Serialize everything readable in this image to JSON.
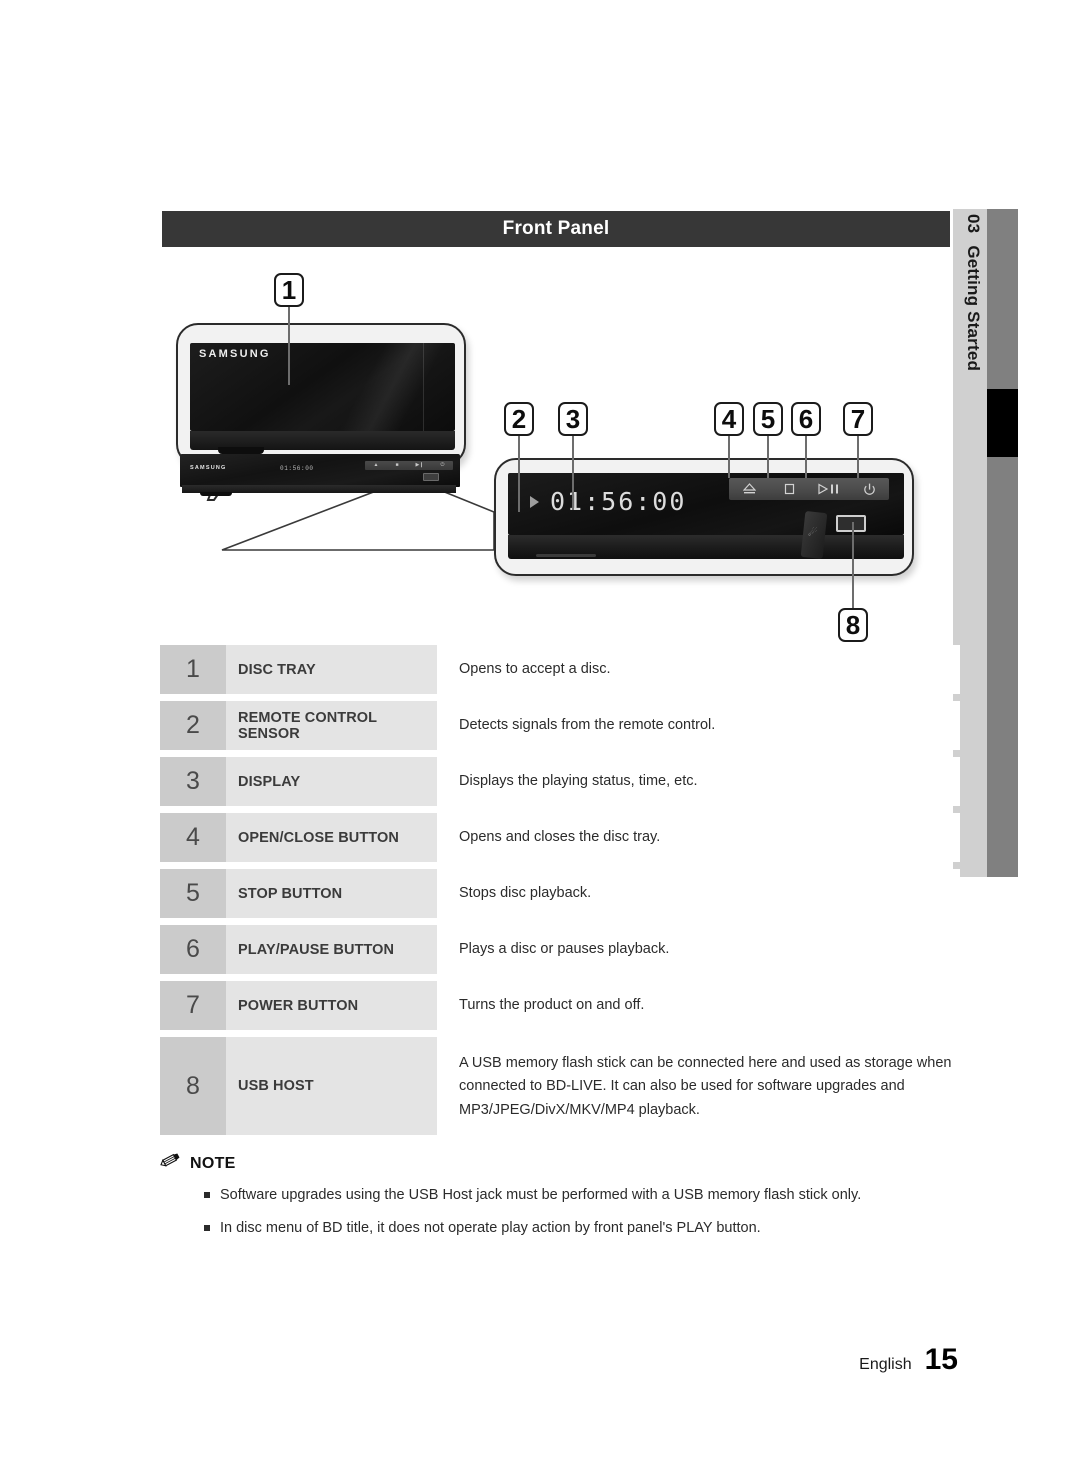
{
  "section": {
    "header_title": "Front Panel",
    "tab_number": "03",
    "tab_label": "Getting Started"
  },
  "figure": {
    "brand": "SAMSUNG",
    "display_time": "01:56:00",
    "display_play_icon": "play-triangle-icon",
    "unit_display_time": "01:56:00",
    "callouts": [
      {
        "id": "1",
        "target": "disc-tray"
      },
      {
        "id": "2",
        "target": "remote-control-sensor"
      },
      {
        "id": "3",
        "target": "display"
      },
      {
        "id": "4",
        "target": "open-close-button"
      },
      {
        "id": "5",
        "target": "stop-button"
      },
      {
        "id": "6",
        "target": "play-pause-button"
      },
      {
        "id": "7",
        "target": "power-button"
      },
      {
        "id": "8",
        "target": "usb-host"
      }
    ],
    "panel_buttons": [
      {
        "name": "eject-icon",
        "label": "OPEN/CLOSE"
      },
      {
        "name": "stop-icon",
        "label": "STOP"
      },
      {
        "name": "play-pause-icon",
        "label": "PLAY/PAUSE"
      },
      {
        "name": "power-icon",
        "label": "POWER"
      }
    ],
    "usb_icon": "usb-icon"
  },
  "table": {
    "rows": [
      {
        "number": "1",
        "label": "DISC TRAY",
        "description": "Opens to accept a disc."
      },
      {
        "number": "2",
        "label": "REMOTE CONTROL SENSOR",
        "description": "Detects signals from the remote control."
      },
      {
        "number": "3",
        "label": "DISPLAY",
        "description": "Displays the playing status, time, etc."
      },
      {
        "number": "4",
        "label": "OPEN/CLOSE BUTTON",
        "description": "Opens and closes the disc tray."
      },
      {
        "number": "5",
        "label": "STOP BUTTON",
        "description": "Stops disc playback."
      },
      {
        "number": "6",
        "label": "PLAY/PAUSE BUTTON",
        "description": "Plays a disc or pauses playback."
      },
      {
        "number": "7",
        "label": "POWER BUTTON",
        "description": "Turns the product on and off."
      },
      {
        "number": "8",
        "label": "USB HOST",
        "description": "A USB memory flash stick can be connected here and used as storage when connected to BD-LIVE. It can also be used for software upgrades and MP3/JPEG/DivX/MKV/MP4 playback."
      }
    ]
  },
  "note": {
    "icon": "pencil-icon",
    "title": "NOTE",
    "items": [
      "Software upgrades using the USB Host jack must be performed with a USB memory flash stick only.",
      "In disc menu of BD title, it does not operate play action by front panel's PLAY button."
    ]
  },
  "footer": {
    "language": "English",
    "page_number": "15"
  },
  "colors": {
    "header_bar": "#373737",
    "tab_light": "#d0d0d0",
    "tab_gray": "#808080",
    "tab_marker": "#000000",
    "number_cell": "#cbcbcb",
    "label_cell": "#e4e4e4"
  }
}
